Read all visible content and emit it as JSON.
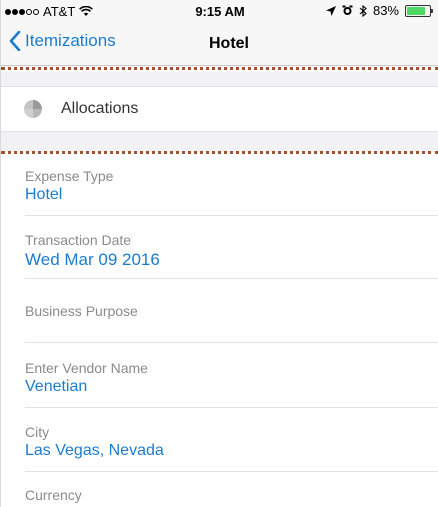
{
  "status_bar": {
    "carrier": "AT&T",
    "time": "9:15 AM",
    "battery_percent": "83%",
    "battery_level": 0.83
  },
  "nav": {
    "back_label": "Itemizations",
    "title": "Hotel"
  },
  "allocations": {
    "label": "Allocations",
    "icon": "pie-chart-icon"
  },
  "fields": [
    {
      "label": "Expense Type",
      "value": "Hotel"
    },
    {
      "label": "Transaction Date",
      "value": "Wed Mar 09 2016"
    },
    {
      "label": "Business Purpose",
      "value": ""
    },
    {
      "label": "Enter Vendor Name",
      "value": "Venetian"
    },
    {
      "label": "City",
      "value": "Las Vegas, Nevada"
    },
    {
      "label": "Currency",
      "value": ""
    }
  ],
  "colors": {
    "accent": "#1a7cd1",
    "annotation": "#a0522d",
    "battery": "#4cd964"
  }
}
